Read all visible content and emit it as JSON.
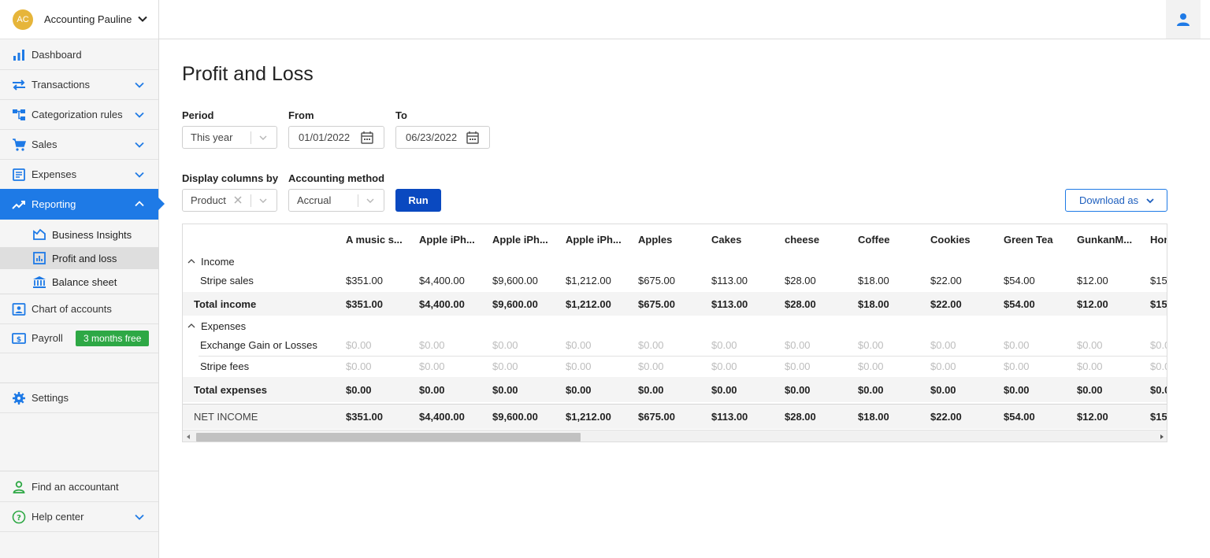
{
  "company": {
    "initials": "AC",
    "name": "Accounting Pauline"
  },
  "nav": {
    "dashboard": "Dashboard",
    "transactions": "Transactions",
    "categorization": "Categorization rules",
    "sales": "Sales",
    "expenses": "Expenses",
    "reporting": "Reporting",
    "business_insights": "Business Insights",
    "profit_loss": "Profit and loss",
    "balance_sheet": "Balance sheet",
    "chart_of_accounts": "Chart of accounts",
    "payroll": "Payroll",
    "payroll_badge": "3 months free",
    "settings": "Settings",
    "find_accountant": "Find an accountant",
    "help_center": "Help center"
  },
  "colors": {
    "accent": "#1e7ae6",
    "run": "#0a49c0",
    "badge": "#2ea845",
    "avatar": "#e6b53a"
  },
  "page": {
    "title": "Profit and Loss"
  },
  "filters": {
    "period_label": "Period",
    "period_value": "This year",
    "from_label": "From",
    "from_value": "01/01/2022",
    "to_label": "To",
    "to_value": "06/23/2022",
    "display_label": "Display columns by",
    "display_value": "Product",
    "method_label": "Accounting method",
    "method_value": "Accrual",
    "run": "Run",
    "download": "Download as"
  },
  "table": {
    "columns": [
      "A music s...",
      "Apple iPh...",
      "Apple iPh...",
      "Apple iPh...",
      "Apples",
      "Cakes",
      "cheese",
      "Coffee",
      "Cookies",
      "Green Tea",
      "GunkanM...",
      "Hon"
    ],
    "income_section": "Income",
    "stripe_sales": {
      "label": "Stripe sales",
      "values": [
        "$351.00",
        "$4,400.00",
        "$9,600.00",
        "$1,212.00",
        "$675.00",
        "$113.00",
        "$28.00",
        "$18.00",
        "$22.00",
        "$54.00",
        "$12.00",
        "$15"
      ]
    },
    "total_income": {
      "label": "Total income",
      "values": [
        "$351.00",
        "$4,400.00",
        "$9,600.00",
        "$1,212.00",
        "$675.00",
        "$113.00",
        "$28.00",
        "$18.00",
        "$22.00",
        "$54.00",
        "$12.00",
        "$15"
      ]
    },
    "expenses_section": "Expenses",
    "exchange": {
      "label": "Exchange Gain or Losses",
      "values": [
        "$0.00",
        "$0.00",
        "$0.00",
        "$0.00",
        "$0.00",
        "$0.00",
        "$0.00",
        "$0.00",
        "$0.00",
        "$0.00",
        "$0.00",
        "$0.0"
      ]
    },
    "stripe_fees": {
      "label": "Stripe fees",
      "values": [
        "$0.00",
        "$0.00",
        "$0.00",
        "$0.00",
        "$0.00",
        "$0.00",
        "$0.00",
        "$0.00",
        "$0.00",
        "$0.00",
        "$0.00",
        "$0.0"
      ]
    },
    "total_expenses": {
      "label": "Total expenses",
      "values": [
        "$0.00",
        "$0.00",
        "$0.00",
        "$0.00",
        "$0.00",
        "$0.00",
        "$0.00",
        "$0.00",
        "$0.00",
        "$0.00",
        "$0.00",
        "$0.0"
      ]
    },
    "net_income": {
      "label": "NET INCOME",
      "values": [
        "$351.00",
        "$4,400.00",
        "$9,600.00",
        "$1,212.00",
        "$675.00",
        "$113.00",
        "$28.00",
        "$18.00",
        "$22.00",
        "$54.00",
        "$12.00",
        "$15"
      ]
    }
  }
}
